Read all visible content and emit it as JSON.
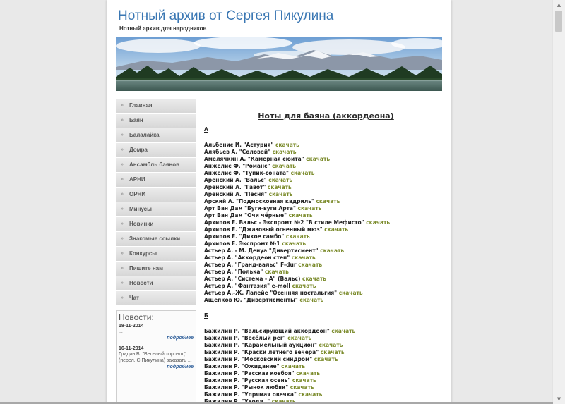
{
  "header": {
    "title": "Нотный архив от Сергея Пикулина",
    "subtitle": "Нотный архив для народников"
  },
  "menu": [
    "Главная",
    "Баян",
    "Балалайка",
    "Домра",
    "Ансамбль баянов",
    "АРНИ",
    "ОРНИ",
    "Минусы",
    "Новинки",
    "Знакомые ссылки",
    "Конкурсы",
    "Пишите нам",
    "Новости",
    "Чат"
  ],
  "menu_bullet": "»",
  "news": {
    "title": "Новости:",
    "items": [
      {
        "date": "18-11-2014",
        "text": "...",
        "more": "подробнее"
      },
      {
        "date": "16-11-2014",
        "text": "Гридин В. \"Веселый хоровод\" (перел. С.Пикулина) заказать ...",
        "more": "подробнее"
      }
    ]
  },
  "content": {
    "title": "Ноты для баяна (аккордеона)",
    "download_label": "скачать",
    "sections": [
      {
        "letter": "А",
        "items": [
          "Альбенис И. \"Астурия\"",
          "Алябьев А. \"Соловей\"",
          "Амелячкин А. \"Камерная сюита\"",
          "Анжелис Ф. \"Романс\"",
          "Анжелис Ф. \"Тупик-соната\"",
          "Аренский А. \"Вальс\"",
          "Аренский А. \"Гавот\"",
          "Аренский А. \"Песня\"",
          "Арский А. \"Подмосковная кадриль\"",
          "Арт Ван Дам \"Буги-вуги Арта\"",
          "Арт Ван Дам \"Очи чёрные\"",
          "Архипов Е. Вальс - Экспромт №2 \"В стиле Мефисто\"",
          "Архипов Е. \"Джазовый огненный мюз\"",
          "Архипов Е. \"Дикое самбо\"",
          "Архипов Е. Экспромт №1",
          "Астьер А. - М. Денуа \"Дивертисмент\"",
          "Астьер А. \"Аккордеон степ\"",
          "Астьер А. \"Гранд-вальс\" F-dur",
          "Астьер А. \"Полька\"",
          "Астьер А. \"Система - А\" (Вальс)",
          "Астьер А. \"Фантазия\" e-moll",
          "Астьер А.-Ж. Лапейе \"Осенняя ностальгия\"",
          "Ащепков Ю. \"Дивертисменты\""
        ]
      },
      {
        "letter": "Б",
        "items": [
          "Бажилин Р. \"Вальсирующий аккордеон\"",
          "Бажилин Р. \"Весёлый рег\"",
          "Бажилин Р. \"Карамельный аукцион\"",
          "Бажилин Р. \"Краски летнего вечера\"",
          "Бажилин Р. \"Московский синдром\"",
          "Бажилин Р. \"Ожидание\"",
          "Бажилин Р. \"Рассказ ковбоя\"",
          "Бажилин Р. \"Русская осень\"",
          "Бажилин Р. \"Рынок любви\"",
          "Бажилин Р. \"Упрямая овечка\"",
          "Бажилин Р. \"Уходя..\""
        ]
      }
    ]
  },
  "colors": {
    "title": "#3a77b3",
    "download_link": "#7a8a2a",
    "news_more": "#2f5f9a"
  }
}
